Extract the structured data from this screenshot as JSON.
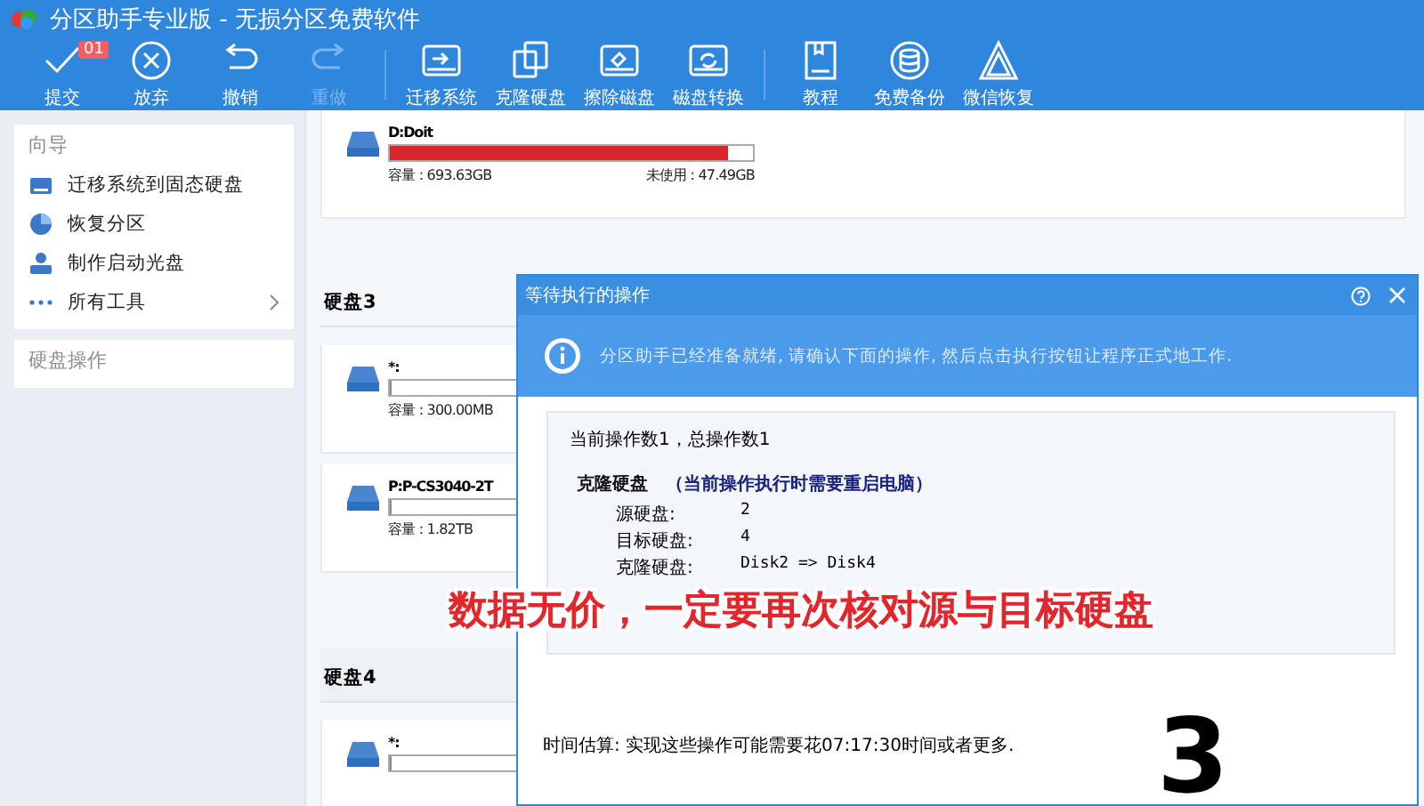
{
  "window": {
    "title": "分区助手专业版 - 无损分区免费软件"
  },
  "toolbar": {
    "groups": [
      [
        {
          "label": "提交",
          "disabled": false,
          "badge": "01"
        },
        {
          "label": "放弃",
          "disabled": false
        },
        {
          "label": "撤销",
          "disabled": false
        },
        {
          "label": "重做",
          "disabled": true
        }
      ],
      [
        {
          "label": "迁移系统",
          "disabled": false
        },
        {
          "label": "克隆硬盘",
          "disabled": false
        },
        {
          "label": "擦除磁盘",
          "disabled": false
        },
        {
          "label": "磁盘转换",
          "disabled": false
        }
      ],
      [
        {
          "label": "教程",
          "disabled": false
        },
        {
          "label": "免费备份",
          "disabled": false
        },
        {
          "label": "微信恢复",
          "disabled": false
        }
      ]
    ]
  },
  "sidebar": {
    "sections": [
      {
        "title": "向导",
        "items": [
          {
            "label": "迁移系统到固态硬盘",
            "has_arrow": false
          },
          {
            "label": "恢复分区",
            "has_arrow": false
          },
          {
            "label": "制作启动光盘",
            "has_arrow": false
          },
          {
            "label": "所有工具",
            "has_arrow": true
          }
        ]
      },
      {
        "title": "硬盘操作"
      }
    ]
  },
  "disks": [
    {
      "kind": "partition",
      "name": "D:Doit",
      "level": 0.93,
      "capacity": "容量 : 693.63GB",
      "free": "未使用 : 47.49GB"
    },
    {
      "kind": "header",
      "name": "硬盘3"
    },
    {
      "kind": "partition",
      "name": "*:",
      "level": 0,
      "capacity": "容量 : 300.00MB"
    },
    {
      "kind": "partition",
      "name": "P:P-CS3040-2T",
      "level": 0,
      "capacity": "容量 : 1.82TB"
    },
    {
      "kind": "header",
      "name": "硬盘4"
    },
    {
      "kind": "partition",
      "name": "*:",
      "level": 0
    }
  ],
  "dialog": {
    "title": "等待执行的操作",
    "info": "分区助手已经准备就绪, 请确认下面的操作, 然后点击执行按钮让程序正式地工作.",
    "summary": "当前操作数1，总操作数1",
    "operation": {
      "title": "克隆硬盘",
      "note": "（当前操作执行时需要重启电脑）",
      "details": [
        {
          "label": "源硬盘:",
          "value": "2"
        },
        {
          "label": "目标硬盘:",
          "value": "4"
        },
        {
          "label": "克隆硬盘:",
          "value": "Disk2 => Disk4"
        }
      ]
    },
    "estimate": "时间估算: 实现这些操作可能需要花07:17:30时间或者更多."
  },
  "annotations": {
    "caption": "数据无价，一定要再次核对源与目标硬盘",
    "step": "3"
  }
}
